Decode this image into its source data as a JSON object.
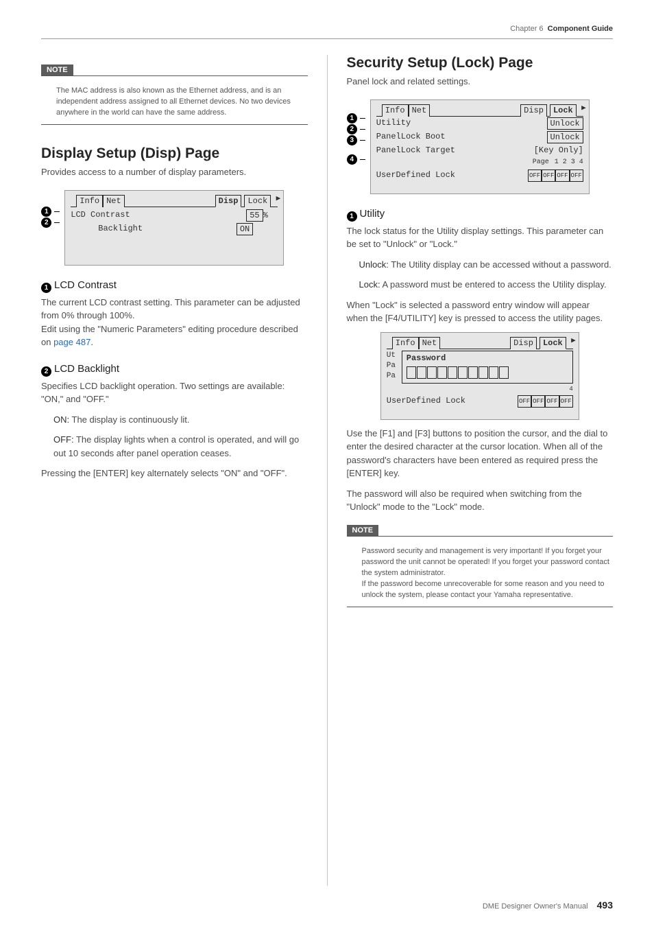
{
  "header": {
    "chapter": "Chapter 6",
    "section": "Component Guide"
  },
  "footer": {
    "manual": "DME Designer Owner's Manual",
    "page": "493"
  },
  "left": {
    "note1": {
      "label": "NOTE",
      "body": "The MAC address is also known as the Ethernet address, and is an independent address assigned to all Ethernet devices. No two devices anywhere in the world can have the same address."
    },
    "h_disp": "Display Setup (Disp) Page",
    "desc_disp": "Provides access to a number of display parameters.",
    "lcd_disp": {
      "tabs": [
        "Info",
        "Net",
        "Disp",
        "Lock"
      ],
      "row1_label": "LCD Contrast",
      "row1_value": "55",
      "row1_suffix": "%",
      "row2_label": "Backlight",
      "row2_value": "ON"
    },
    "sub1_num": "1",
    "sub1_title": "LCD Contrast",
    "sub1_body1": "The current LCD contrast setting. This parameter can be adjusted from 0% through 100%.",
    "sub1_body2a": "Edit using the \"Numeric Parameters\" editing procedure described on ",
    "sub1_link": "page 487",
    "sub1_body2b": ".",
    "sub2_num": "2",
    "sub2_title": "LCD Backlight",
    "sub2_body": "Specifies LCD backlight operation. Two settings are available: \"ON,\" and \"OFF.\"",
    "sub2_on_label": "ON:",
    "sub2_on_text": " The display is continuously lit.",
    "sub2_off_label": "OFF:",
    "sub2_off_text": " The display lights when a control is operated, and will go out 10 seconds after panel operation ceases.",
    "sub2_tail": "Pressing the [ENTER] key alternately selects \"ON\" and \"OFF\"."
  },
  "right": {
    "h_lock": "Security Setup (Lock) Page",
    "desc_lock": "Panel lock and related settings.",
    "lcd_lock": {
      "tabs": [
        "Info",
        "Net",
        "Disp",
        "Lock"
      ],
      "r1_label": "Utility",
      "r1_value": "Unlock",
      "r2_label": "PanelLock Boot",
      "r2_value": "Unlock",
      "r3_label": "PanelLock Target",
      "r3_value": "[Key Only]",
      "r4_pages_label": "Page",
      "r4_pages": "1  2  3  4",
      "r4_label": "UserDefined Lock",
      "r4_off": "OFF"
    },
    "sub1_num": "1",
    "sub1_title": "Utility",
    "sub1_body": "The lock status for the Utility display settings. This parameter can be set to \"Unlock\" or \"Lock.\"",
    "unlock_label": "Unlock:",
    "unlock_text": " The Utility display can be accessed without a password.",
    "lock_label": "Lock:",
    "lock_text": " A password must be entered to access the Utility display.",
    "mid1": "When \"Lock\" is selected a password entry window will appear when the [F4/UTILITY] key is pressed to access the utility pages.",
    "lcd_pwd": {
      "tabs": [
        "Info",
        "Net",
        "Disp",
        "Lock"
      ],
      "left_labels": [
        "Ut",
        "Pa",
        "Pa"
      ],
      "pwd_label": "Password",
      "bottom_label": "UserDefined Lock",
      "off": "OFF",
      "tail_num": "4"
    },
    "mid2": "Use the [F1] and [F3] buttons to position the cursor, and the dial to enter the desired character at the cursor location. When all of the password's characters have been entered as required press the [ENTER] key.",
    "mid3": "The password will also be required when switching from the \"Unlock\" mode to the \"Lock\" mode.",
    "note2": {
      "label": "NOTE",
      "body": "Password security and management is very important! If you forget your password the unit cannot be operated! If you forget your password contact the system administrator.\nIf the password become unrecoverable for some reason and you need to unlock the system, please contact your Yamaha representative."
    }
  }
}
